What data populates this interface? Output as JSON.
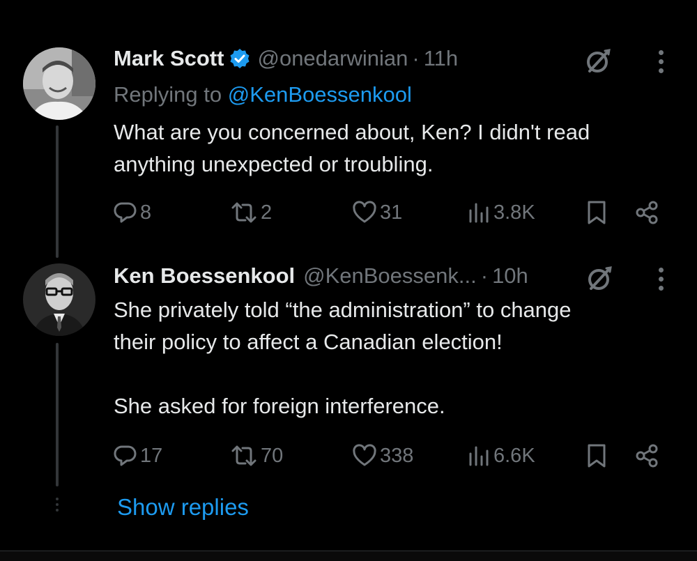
{
  "tweets": [
    {
      "author_name": "Mark Scott",
      "handle": "@onedarwinian",
      "separator": "·",
      "time": "11h",
      "replying_prefix": "Replying to",
      "replying_to": "@KenBoessenkool",
      "text": "What are you concerned about, Ken? I didn't read anything unexpected or troubling.",
      "replies": "8",
      "reposts": "2",
      "likes": "31",
      "views": "3.8K"
    },
    {
      "author_name": "Ken Boessenkool",
      "handle": "@KenBoessenk...",
      "separator": "·",
      "time": "10h",
      "text": "She privately told “the administration” to change\ntheir policy to affect  a Canadian election!\n\nShe asked for foreign interference.",
      "replies": "17",
      "reposts": "70",
      "likes": "338",
      "views": "6.6K"
    }
  ],
  "show_replies_label": "Show replies",
  "icons": {
    "verified": "verified-badge-icon",
    "grok": "grok-icon",
    "more": "more-options-icon",
    "reply": "reply-icon",
    "repost": "repost-icon",
    "like": "like-icon",
    "views": "views-icon",
    "bookmark": "bookmark-icon",
    "share": "share-icon"
  },
  "colors": {
    "background": "#000000",
    "text": "#e7e9ea",
    "muted": "#71767b",
    "accent": "#1d9bf0",
    "thread_line": "#333639"
  }
}
